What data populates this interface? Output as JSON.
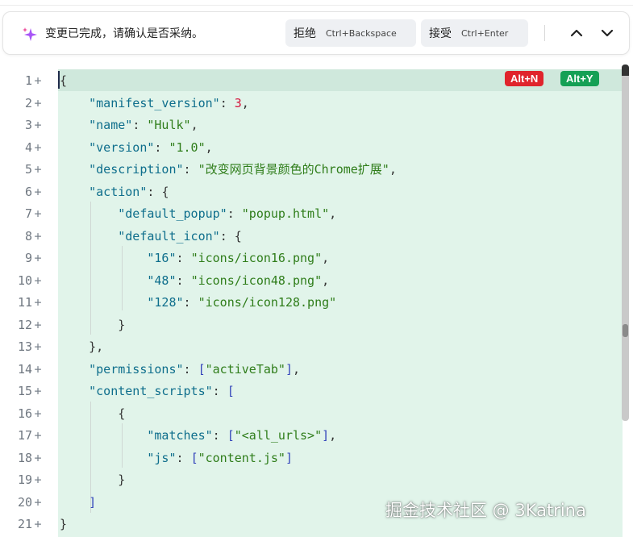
{
  "review": {
    "message": "变更已完成，请确认是否采纳。",
    "reject_label": "拒绝",
    "reject_shortcut": "Ctrl+Backspace",
    "accept_label": "接受",
    "accept_shortcut": "Ctrl+Enter"
  },
  "badges": {
    "reject": "Alt+N",
    "accept": "Alt+Y"
  },
  "colors": {
    "diff_added": "#e1f4ea",
    "reject_badge": "#e0242c",
    "accept_badge": "#15a055"
  },
  "editor": {
    "lines": [
      {
        "n": "1",
        "text": "{"
      },
      {
        "n": "2",
        "text": "    \"manifest_version\": 3,"
      },
      {
        "n": "3",
        "text": "    \"name\": \"Hulk\","
      },
      {
        "n": "4",
        "text": "    \"version\": \"1.0\","
      },
      {
        "n": "5",
        "text": "    \"description\": \"改变网页背景颜色的Chrome扩展\","
      },
      {
        "n": "6",
        "text": "    \"action\": {"
      },
      {
        "n": "7",
        "text": "        \"default_popup\": \"popup.html\","
      },
      {
        "n": "8",
        "text": "        \"default_icon\": {"
      },
      {
        "n": "9",
        "text": "            \"16\": \"icons/icon16.png\","
      },
      {
        "n": "10",
        "text": "            \"48\": \"icons/icon48.png\","
      },
      {
        "n": "11",
        "text": "            \"128\": \"icons/icon128.png\""
      },
      {
        "n": "12",
        "text": "        }"
      },
      {
        "n": "13",
        "text": "    },"
      },
      {
        "n": "14",
        "text": "    \"permissions\": [\"activeTab\"],"
      },
      {
        "n": "15",
        "text": "    \"content_scripts\": ["
      },
      {
        "n": "16",
        "text": "        {"
      },
      {
        "n": "17",
        "text": "            \"matches\": [\"<all_urls>\"],"
      },
      {
        "n": "18",
        "text": "            \"js\": [\"content.js\"]"
      },
      {
        "n": "19",
        "text": "        }"
      },
      {
        "n": "20",
        "text": "    ]"
      },
      {
        "n": "21",
        "text": "}"
      }
    ],
    "gutter_mark": "+"
  },
  "watermark": "掘金技术社区 @ 3Katrina"
}
